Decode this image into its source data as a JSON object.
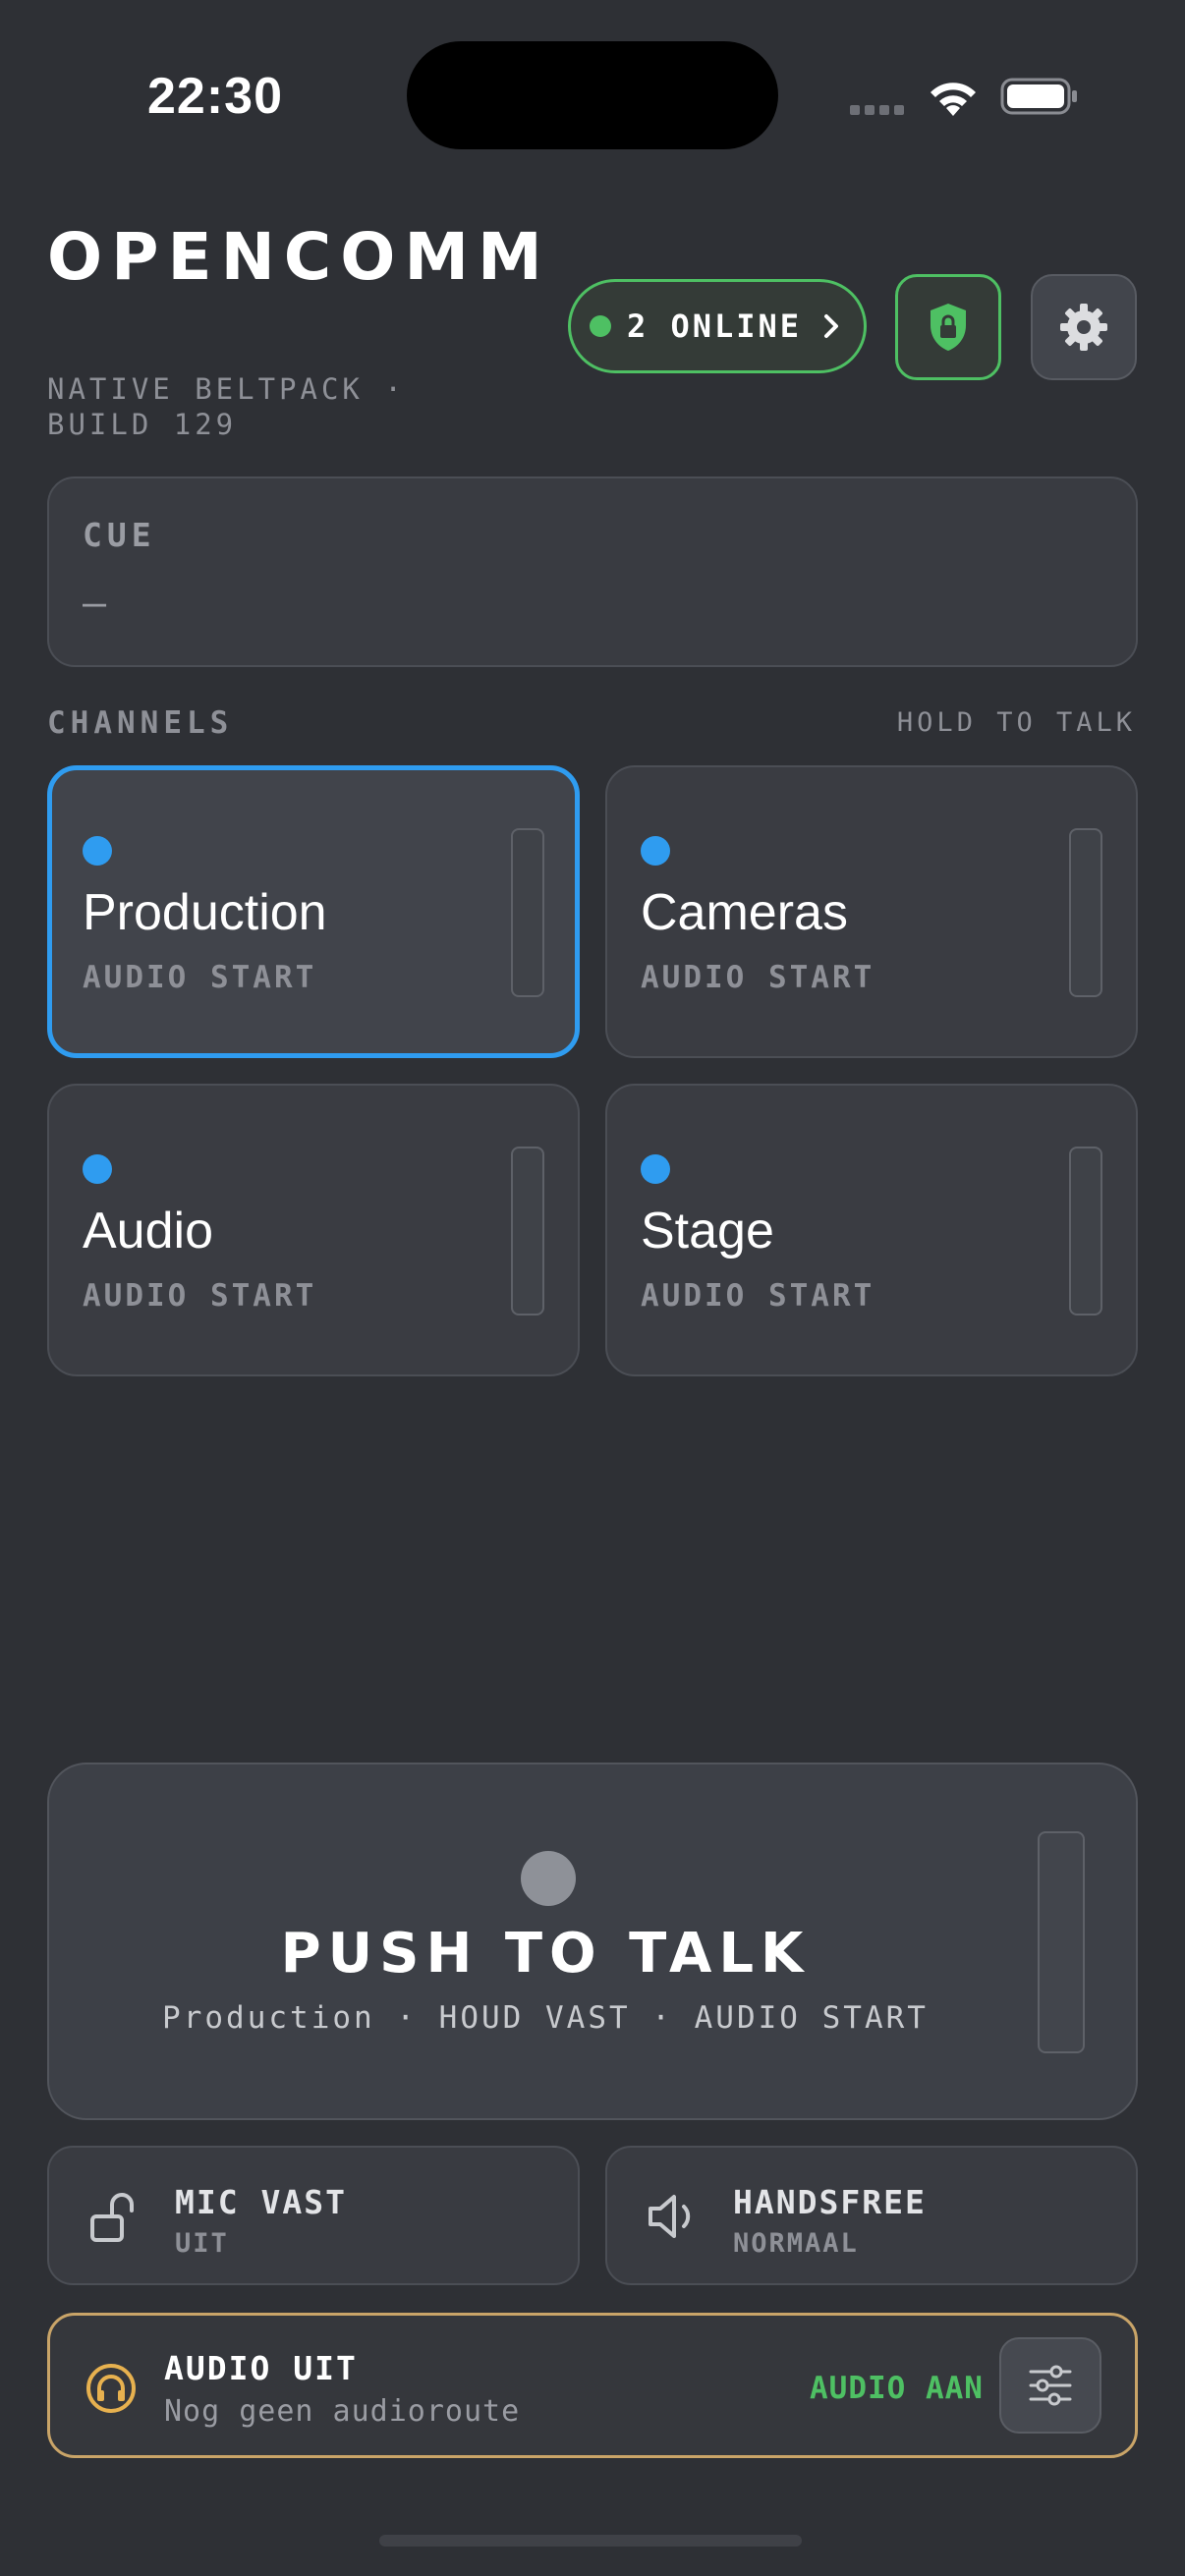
{
  "status_bar": {
    "time": "22:30"
  },
  "header": {
    "brand": "OPENCOMM",
    "subtitle": "NATIVE BELTPACK · BUILD 129",
    "online_label": "2 ONLINE"
  },
  "cue": {
    "label": "CUE",
    "value": "—"
  },
  "channels_section": {
    "label": "CHANNELS",
    "hint": "HOLD TO TALK"
  },
  "channels": [
    {
      "name": "Production",
      "status": "AUDIO START",
      "active": true
    },
    {
      "name": "Cameras",
      "status": "AUDIO START",
      "active": false
    },
    {
      "name": "Audio",
      "status": "AUDIO START",
      "active": false
    },
    {
      "name": "Stage",
      "status": "AUDIO START",
      "active": false
    }
  ],
  "ptt": {
    "title": "PUSH TO TALK",
    "subtitle": "Production · HOUD VAST · AUDIO START"
  },
  "toggles": {
    "mic": {
      "title": "MIC VAST",
      "value": "UIT"
    },
    "handsfree": {
      "title": "HANDSFREE",
      "value": "NORMAAL"
    }
  },
  "audio": {
    "title": "AUDIO UIT",
    "subtitle": "Nog geen audioroute",
    "action": "AUDIO AAN"
  },
  "colors": {
    "background": "#2e3035",
    "accent_blue": "#2f9cf0",
    "online_green": "#4ec063",
    "audio_warning": "#c9a468"
  }
}
